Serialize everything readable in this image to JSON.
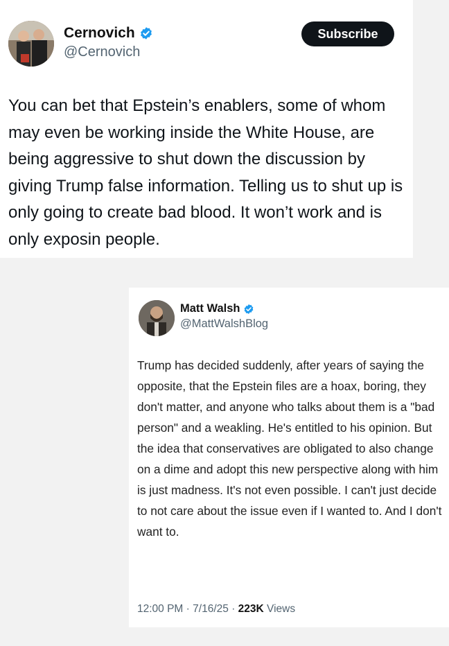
{
  "tweet1": {
    "display_name": "Cernovich",
    "handle": "@Cernovich",
    "subscribe_label": "Subscribe",
    "text": "You can bet that Epstein’s enablers, some of whom may even be working inside the White House, are being aggressive to shut down the discussion by giving Trump false information. Telling us to shut up is only going to create bad blood. It won’t work and is only exposin people.",
    "verified_icon": "verified-badge-icon"
  },
  "tweet2": {
    "display_name": "Matt Walsh",
    "handle": "@MattWalshBlog",
    "text": "Trump has decided suddenly, after years of saying the opposite, that the Epstein files are a hoax, boring, they don't matter, and anyone who talks about them is a \"bad person\" and a weakling. He's entitled to his opinion. But the idea that conservatives are obligated to also change on a dime and adopt this new perspective along with him is just madness. It's not even possible. I can't just decide to not care about the issue even if I wanted to. And I don't want to.",
    "time": "12:00 PM",
    "date": "7/16/25",
    "separator": "·",
    "views_count": "223K",
    "views_label": "Views",
    "verified_icon": "verified-badge-icon"
  },
  "colors": {
    "verified": "#1d9bf0",
    "subscribe_bg": "#0f1419",
    "handle": "#536471",
    "page_bg": "#f2f2f2"
  }
}
